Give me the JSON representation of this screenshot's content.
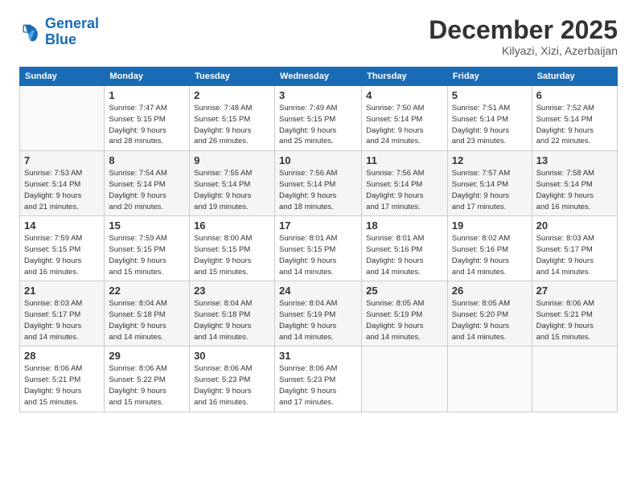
{
  "logo": {
    "line1": "General",
    "line2": "Blue"
  },
  "title": "December 2025",
  "location": "Kilyazi, Xizi, Azerbaijan",
  "headers": [
    "Sunday",
    "Monday",
    "Tuesday",
    "Wednesday",
    "Thursday",
    "Friday",
    "Saturday"
  ],
  "weeks": [
    [
      {
        "day": "",
        "info": ""
      },
      {
        "day": "1",
        "info": "Sunrise: 7:47 AM\nSunset: 5:15 PM\nDaylight: 9 hours\nand 28 minutes."
      },
      {
        "day": "2",
        "info": "Sunrise: 7:48 AM\nSunset: 5:15 PM\nDaylight: 9 hours\nand 26 minutes."
      },
      {
        "day": "3",
        "info": "Sunrise: 7:49 AM\nSunset: 5:15 PM\nDaylight: 9 hours\nand 25 minutes."
      },
      {
        "day": "4",
        "info": "Sunrise: 7:50 AM\nSunset: 5:14 PM\nDaylight: 9 hours\nand 24 minutes."
      },
      {
        "day": "5",
        "info": "Sunrise: 7:51 AM\nSunset: 5:14 PM\nDaylight: 9 hours\nand 23 minutes."
      },
      {
        "day": "6",
        "info": "Sunrise: 7:52 AM\nSunset: 5:14 PM\nDaylight: 9 hours\nand 22 minutes."
      }
    ],
    [
      {
        "day": "7",
        "info": "Sunrise: 7:53 AM\nSunset: 5:14 PM\nDaylight: 9 hours\nand 21 minutes."
      },
      {
        "day": "8",
        "info": "Sunrise: 7:54 AM\nSunset: 5:14 PM\nDaylight: 9 hours\nand 20 minutes."
      },
      {
        "day": "9",
        "info": "Sunrise: 7:55 AM\nSunset: 5:14 PM\nDaylight: 9 hours\nand 19 minutes."
      },
      {
        "day": "10",
        "info": "Sunrise: 7:56 AM\nSunset: 5:14 PM\nDaylight: 9 hours\nand 18 minutes."
      },
      {
        "day": "11",
        "info": "Sunrise: 7:56 AM\nSunset: 5:14 PM\nDaylight: 9 hours\nand 17 minutes."
      },
      {
        "day": "12",
        "info": "Sunrise: 7:57 AM\nSunset: 5:14 PM\nDaylight: 9 hours\nand 17 minutes."
      },
      {
        "day": "13",
        "info": "Sunrise: 7:58 AM\nSunset: 5:14 PM\nDaylight: 9 hours\nand 16 minutes."
      }
    ],
    [
      {
        "day": "14",
        "info": "Sunrise: 7:59 AM\nSunset: 5:15 PM\nDaylight: 9 hours\nand 16 minutes."
      },
      {
        "day": "15",
        "info": "Sunrise: 7:59 AM\nSunset: 5:15 PM\nDaylight: 9 hours\nand 15 minutes."
      },
      {
        "day": "16",
        "info": "Sunrise: 8:00 AM\nSunset: 5:15 PM\nDaylight: 9 hours\nand 15 minutes."
      },
      {
        "day": "17",
        "info": "Sunrise: 8:01 AM\nSunset: 5:15 PM\nDaylight: 9 hours\nand 14 minutes."
      },
      {
        "day": "18",
        "info": "Sunrise: 8:01 AM\nSunset: 5:16 PM\nDaylight: 9 hours\nand 14 minutes."
      },
      {
        "day": "19",
        "info": "Sunrise: 8:02 AM\nSunset: 5:16 PM\nDaylight: 9 hours\nand 14 minutes."
      },
      {
        "day": "20",
        "info": "Sunrise: 8:03 AM\nSunset: 5:17 PM\nDaylight: 9 hours\nand 14 minutes."
      }
    ],
    [
      {
        "day": "21",
        "info": "Sunrise: 8:03 AM\nSunset: 5:17 PM\nDaylight: 9 hours\nand 14 minutes."
      },
      {
        "day": "22",
        "info": "Sunrise: 8:04 AM\nSunset: 5:18 PM\nDaylight: 9 hours\nand 14 minutes."
      },
      {
        "day": "23",
        "info": "Sunrise: 8:04 AM\nSunset: 5:18 PM\nDaylight: 9 hours\nand 14 minutes."
      },
      {
        "day": "24",
        "info": "Sunrise: 8:04 AM\nSunset: 5:19 PM\nDaylight: 9 hours\nand 14 minutes."
      },
      {
        "day": "25",
        "info": "Sunrise: 8:05 AM\nSunset: 5:19 PM\nDaylight: 9 hours\nand 14 minutes."
      },
      {
        "day": "26",
        "info": "Sunrise: 8:05 AM\nSunset: 5:20 PM\nDaylight: 9 hours\nand 14 minutes."
      },
      {
        "day": "27",
        "info": "Sunrise: 8:06 AM\nSunset: 5:21 PM\nDaylight: 9 hours\nand 15 minutes."
      }
    ],
    [
      {
        "day": "28",
        "info": "Sunrise: 8:06 AM\nSunset: 5:21 PM\nDaylight: 9 hours\nand 15 minutes."
      },
      {
        "day": "29",
        "info": "Sunrise: 8:06 AM\nSunset: 5:22 PM\nDaylight: 9 hours\nand 15 minutes."
      },
      {
        "day": "30",
        "info": "Sunrise: 8:06 AM\nSunset: 5:23 PM\nDaylight: 9 hours\nand 16 minutes."
      },
      {
        "day": "31",
        "info": "Sunrise: 8:06 AM\nSunset: 5:23 PM\nDaylight: 9 hours\nand 17 minutes."
      },
      {
        "day": "",
        "info": ""
      },
      {
        "day": "",
        "info": ""
      },
      {
        "day": "",
        "info": ""
      }
    ]
  ]
}
